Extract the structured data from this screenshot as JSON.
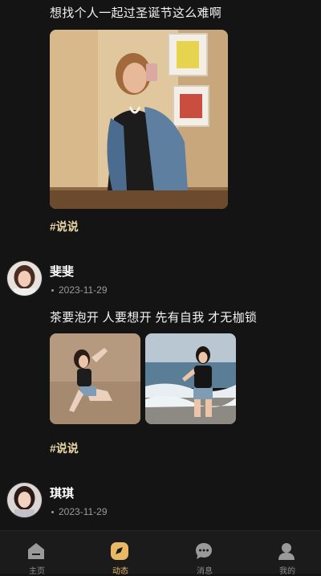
{
  "posts": [
    {
      "text": "想找个人一起过圣诞节这么难啊",
      "tag": "#说说"
    },
    {
      "author": "斐斐",
      "date": "2023-11-29",
      "text": "茶要泡开 人要想开 先有自我 才无枷锁",
      "tag": "#说说"
    },
    {
      "author": "琪琪",
      "date": "2023-11-29"
    }
  ],
  "tabbar": {
    "items": [
      {
        "label": "主页",
        "icon": "home-icon"
      },
      {
        "label": "动态",
        "icon": "compass-icon",
        "active": true
      },
      {
        "label": "消息",
        "icon": "chat-bubble-icon"
      },
      {
        "label": "我的",
        "icon": "person-icon"
      }
    ]
  },
  "colors": {
    "background": "#141414",
    "tag": "#e9d6a6",
    "active_tab": "#e9b866",
    "inactive_tab": "#8c8c8c"
  }
}
